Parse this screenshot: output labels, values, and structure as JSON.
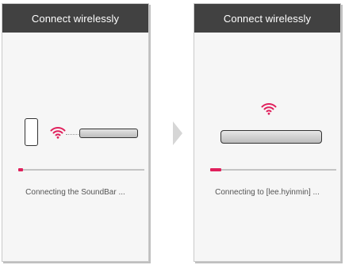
{
  "colors": {
    "title_bar": "#414141",
    "accent": "#e0205c",
    "track": "#c4c4c4"
  },
  "icons": {
    "wifi": "wifi-icon",
    "phone": "smartphone-icon",
    "soundbar": "soundbar-icon",
    "arrow": "right-arrow-icon"
  },
  "screens": [
    {
      "title": "Connect wirelessly",
      "status": "Connecting the SoundBar ...",
      "progress": 0.04
    },
    {
      "title": "Connect wirelessly",
      "status": "Connecting to [lee.hyinmin] ...",
      "progress": 0.09
    }
  ]
}
